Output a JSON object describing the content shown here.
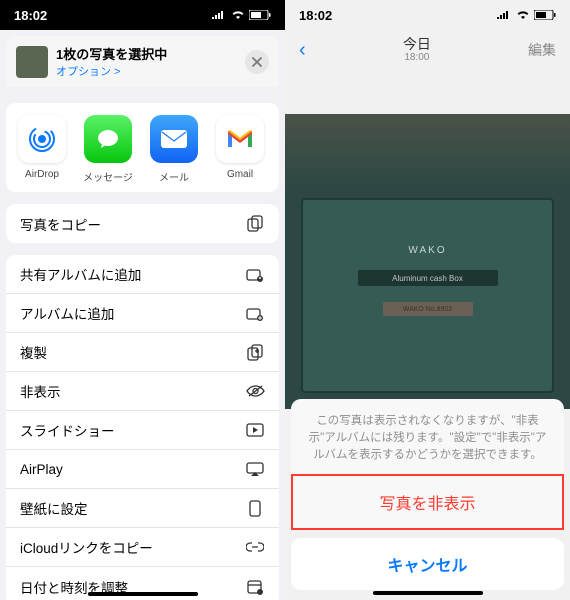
{
  "left": {
    "status_time": "18:02",
    "sheet": {
      "title": "1枚の写真を選択中",
      "options_link": "オプション >"
    },
    "channels": [
      {
        "id": "airdrop",
        "label": "AirDrop"
      },
      {
        "id": "messages",
        "label": "メッセージ"
      },
      {
        "id": "mail",
        "label": "メール"
      },
      {
        "id": "gmail",
        "label": "Gmail"
      }
    ],
    "actions_single": [
      {
        "id": "copy",
        "label": "写真をコピー",
        "icon": "copy"
      }
    ],
    "actions": [
      {
        "id": "add-shared-album",
        "label": "共有アルバムに追加",
        "icon": "shared-album"
      },
      {
        "id": "add-album",
        "label": "アルバムに追加",
        "icon": "album-plus"
      },
      {
        "id": "duplicate",
        "label": "複製",
        "icon": "duplicate"
      },
      {
        "id": "hide",
        "label": "非表示",
        "icon": "eye-slash"
      },
      {
        "id": "slideshow",
        "label": "スライドショー",
        "icon": "play-rect"
      },
      {
        "id": "airplay",
        "label": "AirPlay",
        "icon": "airplay"
      },
      {
        "id": "wallpaper",
        "label": "壁紙に設定",
        "icon": "phone-rect"
      },
      {
        "id": "icloud-link",
        "label": "iCloudリンクをコピー",
        "icon": "link"
      },
      {
        "id": "adjust-datetime",
        "label": "日付と時刻を調整",
        "icon": "calendar"
      }
    ]
  },
  "right": {
    "status_time": "18:02",
    "nav_title": "今日",
    "nav_subtitle": "18:00",
    "nav_edit": "編集",
    "photo_brand": "WAKO",
    "photo_plate": "Aluminum cash Box",
    "photo_tag": "WAKO  No.8902",
    "dialog_message": "この写真は表示されなくなりますが、\"非表示\"アルバムには残ります。\"設定\"で\"非表示\"アルバムを表示するかどうかを選択できます。",
    "hide_button": "写真を非表示",
    "cancel_button": "キャンセル"
  }
}
